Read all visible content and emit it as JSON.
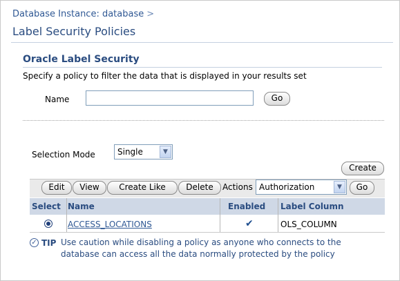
{
  "breadcrumb": {
    "link": "Database Instance: database",
    "separator": ">"
  },
  "page_title": "Label Security Policies",
  "section": {
    "title": "Oracle Label Security",
    "description": "Specify a policy to filter the data that is displayed in your results set"
  },
  "search": {
    "name_label": "Name",
    "name_value": "",
    "go_label": "Go"
  },
  "selection": {
    "label": "Selection Mode",
    "value": "Single"
  },
  "create_label": "Create",
  "toolbar": {
    "edit": "Edit",
    "view": "View",
    "create_like": "Create Like",
    "delete": "Delete",
    "actions_label": "Actions",
    "actions_value": "Authorization",
    "go": "Go"
  },
  "table": {
    "headers": {
      "select": "Select",
      "name": "Name",
      "enabled": "Enabled",
      "label_column": "Label Column"
    },
    "rows": [
      {
        "name": "ACCESS_LOCATIONS",
        "enabled": "✔",
        "label_column": "OLS_COLUMN"
      }
    ]
  },
  "tip": {
    "label": "TIP",
    "text_line1": "Use caution while disabling a policy as anyone who connects to the",
    "text_line2": "database can access all the data normally protected by the policy"
  }
}
